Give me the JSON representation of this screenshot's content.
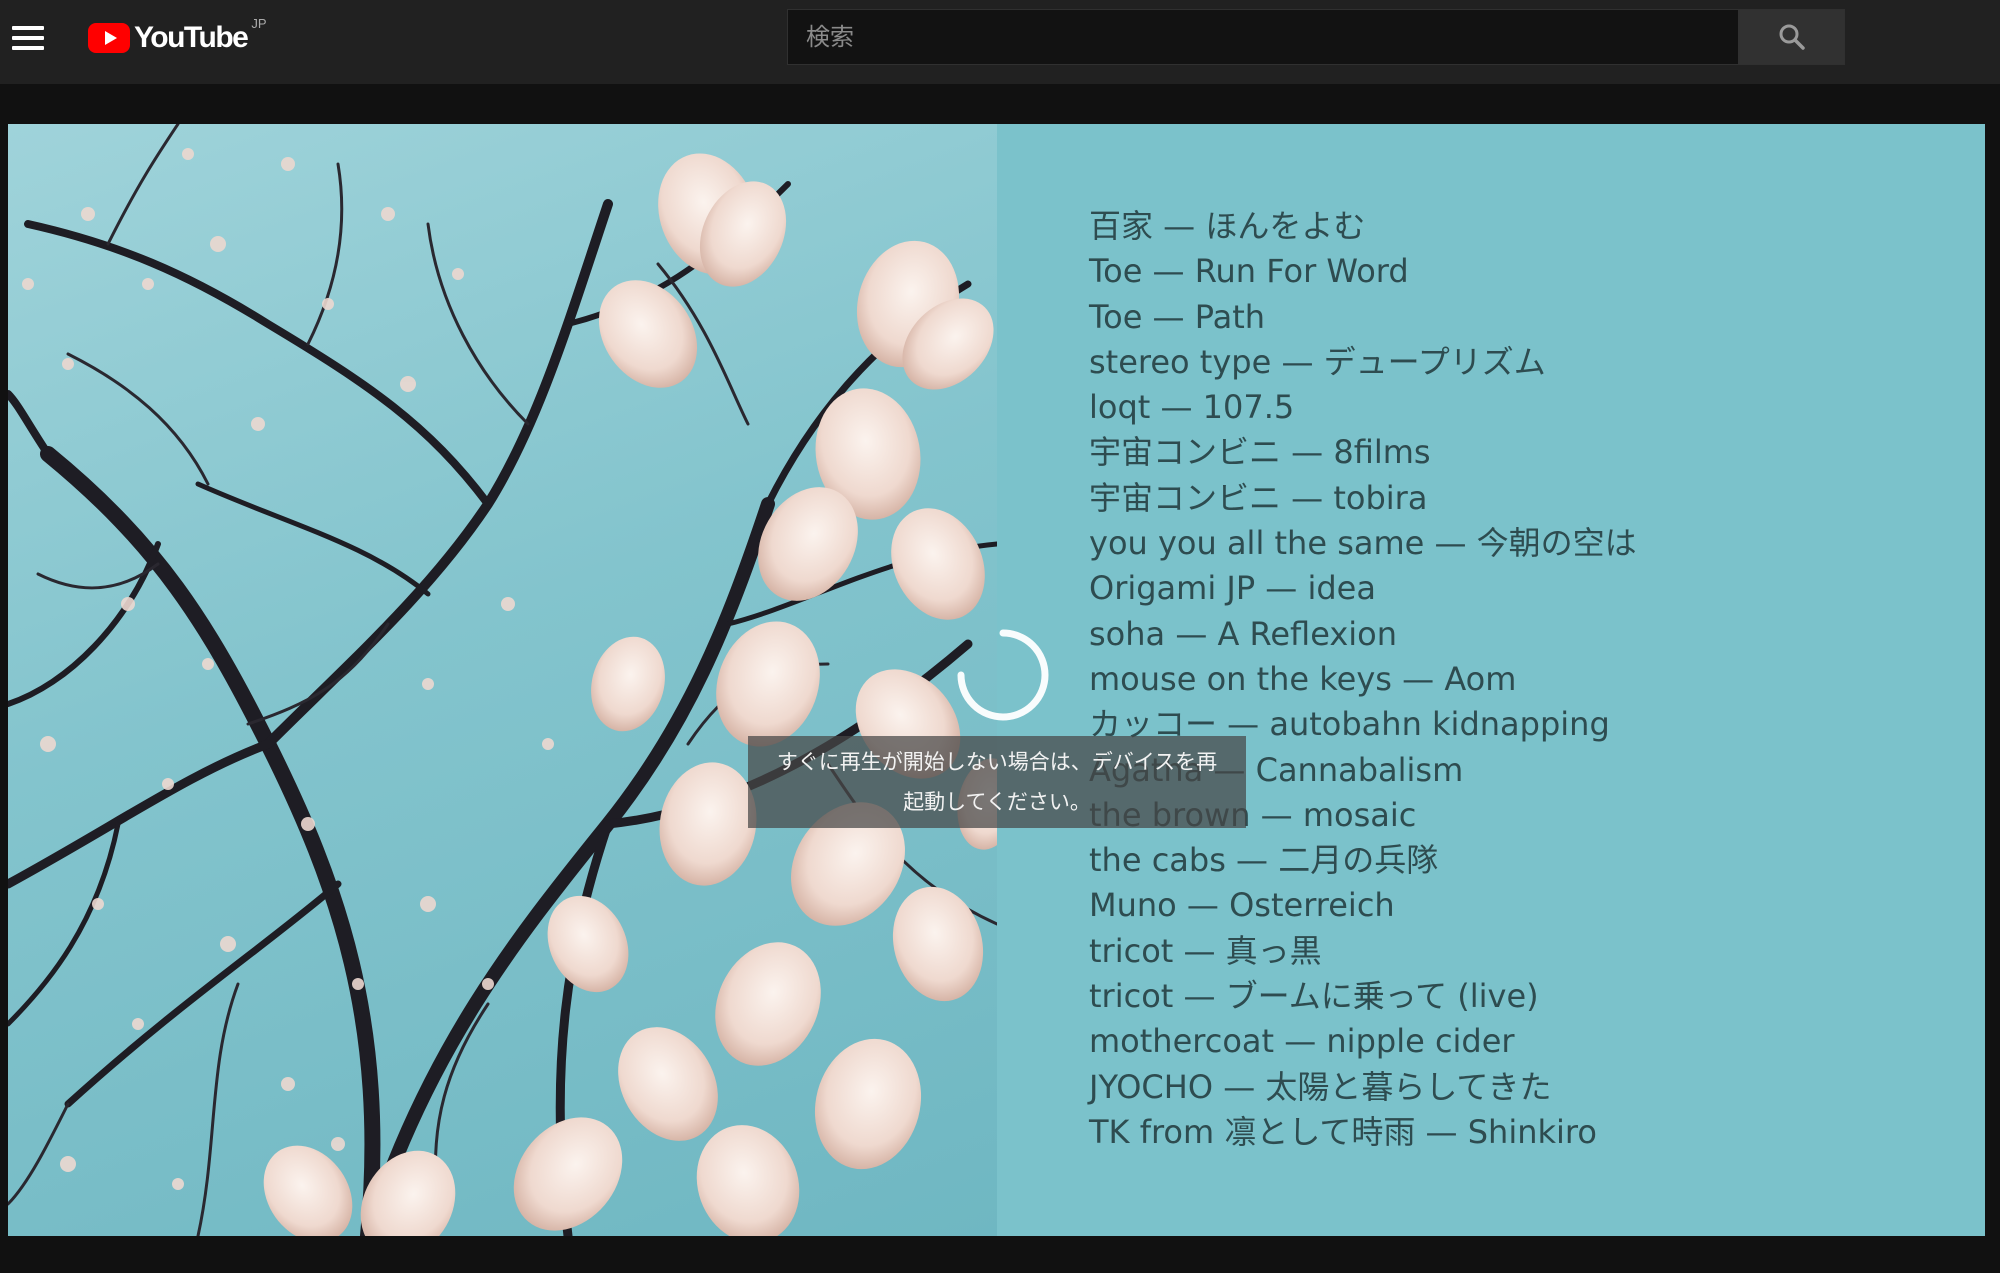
{
  "header": {
    "menu_icon": "hamburger-menu-icon",
    "logo_icon": "youtube-play-icon",
    "logo_text": "YouTube",
    "logo_region": "JP",
    "search_placeholder": "検索",
    "search_icon": "search-icon"
  },
  "player": {
    "thumbnail_description_icon": "magnolia-branches-image",
    "tracks": [
      "百家 — ほんをよむ",
      "Toe — Run For Word",
      "Toe — Path",
      "stereo type — デュープリズム",
      "loqt — 107.5",
      "宇宙コンビニ — 8films",
      "宇宙コンビニ — tobira",
      "you you all the same — 今朝の空は",
      "Origami JP — idea",
      "soha — A Reflexion",
      "mouse on the keys — Aom",
      "カッコー — autobahn kidnapping",
      "Agatha — Cannabalism",
      "the brown — mosaic",
      "the cabs — 二月の兵隊",
      "Muno — Osterreich",
      "tricot — 真っ黒",
      "tricot — ブームに乗って (live)",
      "mothercoat — nipple cider",
      "JYOCHO — 太陽と暮らしてきた",
      "TK from 凛として時雨  — Shinkiro"
    ],
    "loading_icon": "loading-spinner-icon",
    "message_line1": "すぐに再生が開始しない場合は、デバイスを再",
    "message_line2": "起動してください。"
  },
  "colors": {
    "topbar": "#212121",
    "background": "#111111",
    "panel": "#7bc2cb",
    "track_text": "#2e4c50",
    "youtube_red": "#ff0000"
  }
}
